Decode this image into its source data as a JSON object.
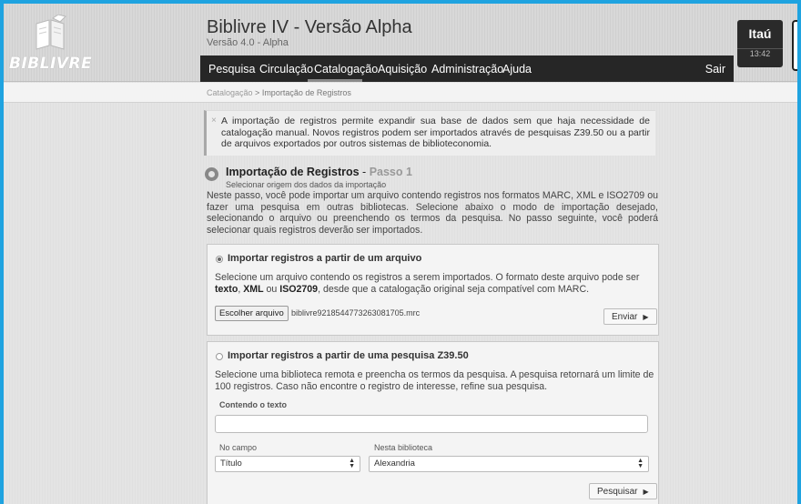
{
  "app": {
    "logo_text": "BIBLIVRE",
    "title": "Biblivre IV - Versão Alpha",
    "version": "Versão 4.0 - Alpha"
  },
  "menu": {
    "items": [
      "Pesquisa",
      "Circulação",
      "Catalogação",
      "Aquisição",
      "Administração",
      "Ajuda"
    ],
    "active": "Catalogação",
    "logout": "Sair"
  },
  "user": {
    "name": "Itaú",
    "time": "13:42"
  },
  "breadcrumb": {
    "parent": "Catalogação",
    "separator": " > ",
    "current": "Importação de Registros"
  },
  "notice": {
    "close": "×",
    "text": "A importação de registros permite expandir sua base de dados sem que haja necessidade de catalogação manual. Novos registros podem ser importados através de pesquisas Z39.50 ou a partir de arquivos exportados por outros sistemas de biblioteconomia."
  },
  "step": {
    "title": "Importação de Registros",
    "separator": " - ",
    "step_label": "Passo 1",
    "subtitle": "Selecionar origem dos dados da importação",
    "description": "Neste passo, você pode importar um arquivo contendo registros nos formatos MARC, XML e ISO2709 ou fazer uma pesquisa em outras bibliotecas. Selecione abaixo o modo de importação desejado, selecionando o arquivo ou preenchendo os termos da pesquisa. No passo seguinte, você poderá selecionar quais registros deverão ser importados."
  },
  "file_import": {
    "selected": true,
    "title": "Importar registros a partir de um arquivo",
    "desc_part1": "Selecione um arquivo contendo os registros a serem importados. O formato deste arquivo pode ser ",
    "fmt_text": "texto",
    "sep1": ", ",
    "fmt_xml": "XML",
    "sep2": " ou ",
    "fmt_iso": "ISO2709",
    "desc_part2": ", desde que a catalogação original seja compatível com MARC.",
    "choose_button": "Escolher arquivo",
    "file_name": "biblivre9218544773263081705.mrc",
    "submit_button": "Enviar"
  },
  "z3950_import": {
    "selected": false,
    "title": "Importar registros a partir de uma pesquisa Z39.50",
    "description": "Selecione uma biblioteca remota e preencha os termos da pesquisa. A pesquisa retornará um limite de 100 registros. Caso não encontre o registro de interesse, refine sua pesquisa.",
    "query_label": "Contendo o texto",
    "query_value": "",
    "field_label": "No campo",
    "field_value": "Título",
    "library_label": "Nesta biblioteca",
    "library_value": "Alexandria",
    "search_button": "Pesquisar"
  }
}
